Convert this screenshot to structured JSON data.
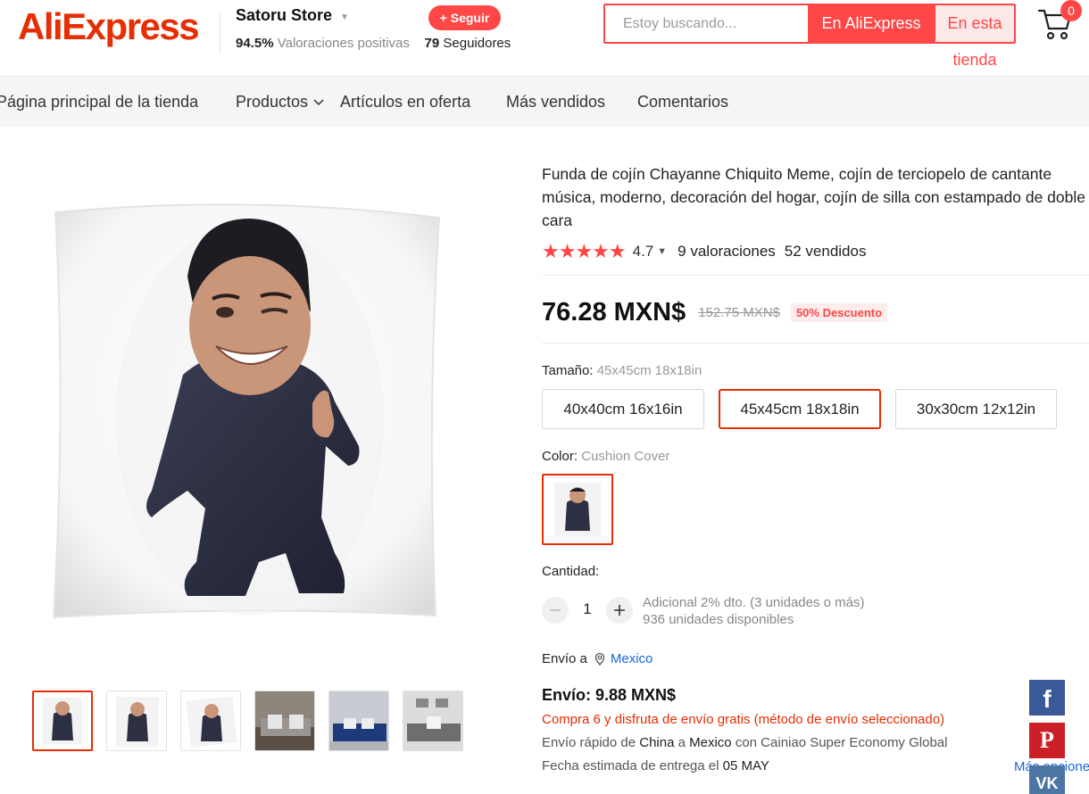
{
  "header": {
    "logo": "AliExpress",
    "store_name": "Satoru Store",
    "positive_rate": "94.5%",
    "positive_label": "Valoraciones positivas",
    "followers": "79",
    "followers_label": "Seguidores",
    "follow_label": "+ Seguir",
    "search_placeholder": "Estoy buscando...",
    "search_all_label": "En AliExpress",
    "search_store_label": "En esta tienda",
    "cart_count": "0"
  },
  "nav": {
    "items": [
      {
        "label": "Página principal de la tienda"
      },
      {
        "label": "Productos"
      },
      {
        "label": "Artículos en oferta"
      },
      {
        "label": "Más vendidos"
      },
      {
        "label": "Comentarios"
      }
    ]
  },
  "product": {
    "title": "Funda de cojín Chayanne Chiquito Meme, cojín de terciopelo de cantante música, moderno, decoración del hogar, cojín de silla con estampado de doble cara",
    "stars": "★★★★★",
    "rating": "4.7",
    "reviews": "9 valoraciones",
    "sold": "52 vendidos",
    "price": "76.28 MXN$",
    "original_price": "152.75 MXN$",
    "discount": "50% Descuento",
    "size_label": "Tamaño:",
    "size_selected": "45x45cm 18x18in",
    "sizes": [
      {
        "label": "40x40cm 16x16in"
      },
      {
        "label": "45x45cm 18x18in"
      },
      {
        "label": "30x30cm 12x12in"
      }
    ],
    "color_label": "Color:",
    "color_selected": "Cushion Cover",
    "quantity_label": "Cantidad:",
    "quantity": "1",
    "quantity_discount": "Adicional 2% dto. (3 unidades o más)",
    "stock": "936 unidades disponibles"
  },
  "shipping": {
    "ship_to_label": "Envío a",
    "ship_to": "Mexico",
    "cost": "Envío: 9.88 MXN$",
    "promo": "Compra 6 y disfruta de envío gratis (método de envío seleccionado)",
    "method_prefix": "Envío rápido de",
    "origin": "China",
    "method_a": "a",
    "destination": "Mexico",
    "method_suffix": "con Cainiao Super Economy Global",
    "date_prefix": "Fecha estimada de entrega el",
    "date": "05 MAY"
  },
  "share": {
    "more_label": "Más opciones"
  },
  "colors": {
    "brand_red": "#e62e04",
    "accent_red": "#ff4747",
    "link_blue": "#1a66d6"
  },
  "icons": [
    "chevron-down-icon",
    "cart-icon",
    "star-icon",
    "location-pin-icon",
    "facebook-icon",
    "pinterest-icon",
    "vk-icon",
    "minus-icon",
    "plus-icon"
  ]
}
